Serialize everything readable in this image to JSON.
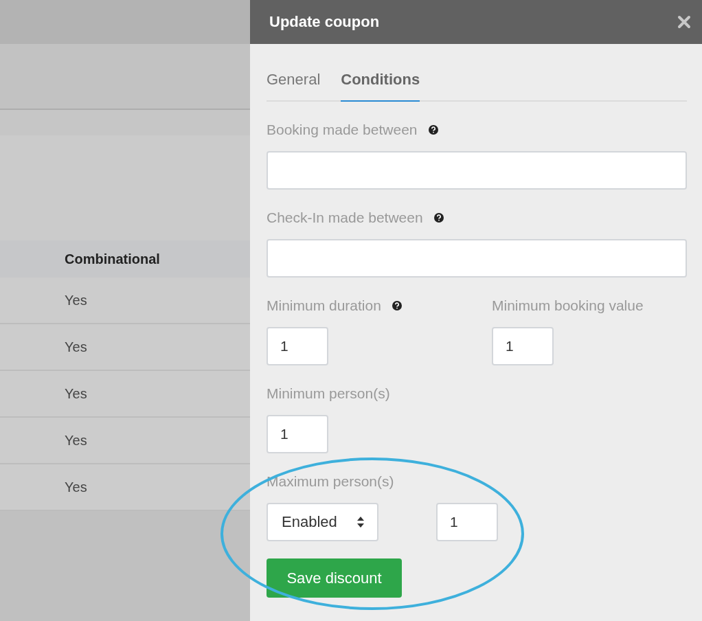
{
  "table": {
    "header": "Combinational",
    "rows": [
      "Yes",
      "Yes",
      "Yes",
      "Yes",
      "Yes"
    ]
  },
  "panel": {
    "title": "Update coupon",
    "tabs": [
      {
        "label": "General",
        "selected": false
      },
      {
        "label": "Conditions",
        "selected": true
      }
    ],
    "conditions": [
      {
        "kind": "wide",
        "label": "Booking made between",
        "help": true
      },
      {
        "kind": "wide",
        "label": "Check-In made between",
        "help": true
      },
      {
        "kind": "pair",
        "items": [
          {
            "label": "Minimum duration",
            "help": true,
            "value": "1"
          },
          {
            "label": "Minimum booking value",
            "help": false,
            "value": "1"
          }
        ]
      },
      {
        "kind": "small",
        "label": "Minimum person(s)",
        "help": false,
        "value": "1"
      },
      {
        "kind": "select",
        "label": "Maximum person(s)",
        "help": false,
        "select": "Enabled",
        "value": "1"
      }
    ],
    "button": "Save discount"
  }
}
